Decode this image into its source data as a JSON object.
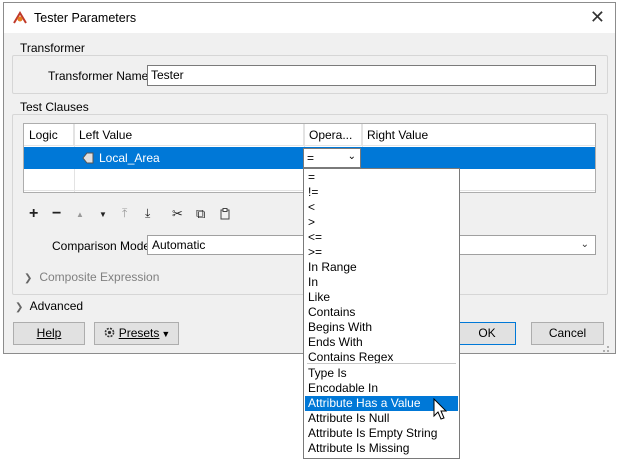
{
  "window": {
    "title": "Tester Parameters",
    "close_glyph": "✕"
  },
  "transformer": {
    "group_label": "Transformer",
    "name_label": "Transformer Name:",
    "name_value": "Tester"
  },
  "test_clauses": {
    "group_label": "Test Clauses",
    "columns": [
      "Logic",
      "Left Value",
      "Opera...",
      "Right Value"
    ],
    "row": {
      "left_value": "Local_Area",
      "operator": "="
    }
  },
  "toolbar": {
    "add": "+",
    "remove": "−",
    "move_up": "▲",
    "move_down": "▼",
    "to_top": "⤒",
    "to_bottom": "⤓",
    "cut": "✂",
    "copy": "⧉",
    "paste": "📋"
  },
  "comparison_mode": {
    "label": "Comparison Mode:",
    "value": "Automatic"
  },
  "composite": {
    "label": "Composite Expression"
  },
  "advanced": {
    "label": "Advanced"
  },
  "buttons": {
    "help": "Help",
    "presets": "Presets",
    "ok": "OK",
    "cancel": "Cancel"
  },
  "operator_options": [
    "=",
    "!=",
    "<",
    ">",
    "<=",
    ">=",
    "In Range",
    "In",
    "Like",
    "Contains",
    "Begins With",
    "Ends With",
    "Contains Regex",
    "Type Is",
    "Encodable In",
    "Attribute Has a Value",
    "Attribute Is Null",
    "Attribute Is Empty String",
    "Attribute Is Missing"
  ],
  "highlighted_option": "Attribute Has a Value",
  "colors": {
    "selection": "#0078d7",
    "dialog_bg": "#f0f0f0"
  }
}
